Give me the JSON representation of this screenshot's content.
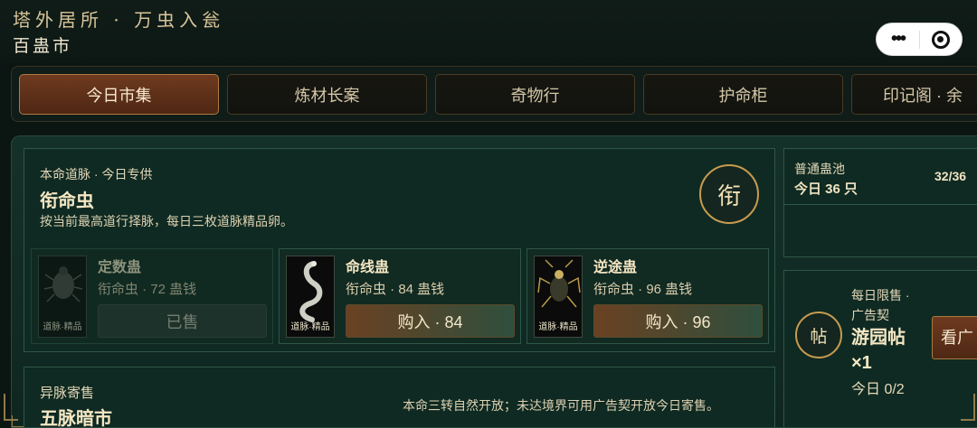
{
  "header": {
    "app_title": "塔外居所 · 万虫入瓮",
    "page_title": "百蛊市"
  },
  "tabs": [
    {
      "label": "今日市集",
      "active": true
    },
    {
      "label": "炼材长案",
      "active": false
    },
    {
      "label": "奇物行",
      "active": false
    },
    {
      "label": "护命柜",
      "active": false
    },
    {
      "label": "印记阁 · 余",
      "active": false
    }
  ],
  "daily_special": {
    "kicker": "本命道脉 · 今日专供",
    "title": "衔命虫",
    "description": "按当前最高道行择脉，每日三枚道脉精品卵。",
    "emblem": "衔",
    "items": [
      {
        "name": "定数蛊",
        "price": "衔命虫 · 72 蛊钱",
        "thumb_caption": "道脉·精品",
        "button": "已售",
        "sold": true
      },
      {
        "name": "命线蛊",
        "price": "衔命虫 · 84 蛊钱",
        "thumb_caption": "道脉·精品",
        "button": "购入 · 84",
        "sold": false
      },
      {
        "name": "逆途蛊",
        "price": "衔命虫 · 96 蛊钱",
        "thumb_caption": "道脉·精品",
        "button": "购入 · 96",
        "sold": false
      }
    ]
  },
  "consignment": {
    "kicker": "异脉寄售",
    "title": "五脉暗市",
    "note": "本命三转自然开放；未达境界可用广告契开放今日寄售。"
  },
  "pool": {
    "label": "普通蛊池",
    "count": "今日 36 只",
    "ratio": "32/36"
  },
  "ad_offer": {
    "kicker": "每日限售 · 广告契",
    "seal": "帖",
    "title": "游园帖 ×1",
    "quota": "今日 0/2",
    "button": "看广"
  },
  "colors": {
    "accent_gold": "#c79b4f",
    "active_tab": "#6e3a1f",
    "panel_green": "#0f2a22"
  }
}
